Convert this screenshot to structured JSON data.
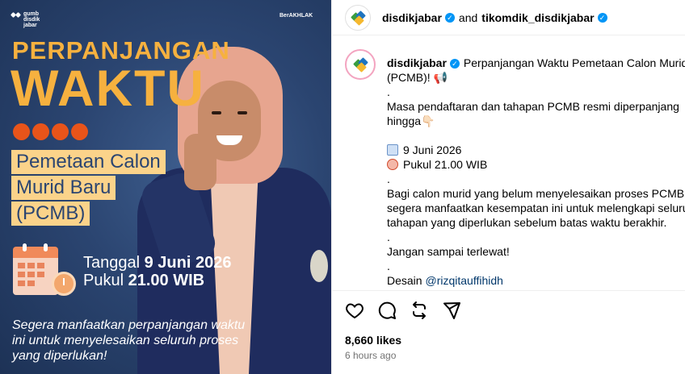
{
  "poster": {
    "logo_left": [
      "gumb",
      "disdik",
      "jabar"
    ],
    "logo_right": "BerAKHLAK",
    "logo_right_sub": "",
    "title_line1": "PERPANJANGAN",
    "title_line2": "WAKTU",
    "subject_lines": [
      "Pemetaan Calon",
      "Murid Baru",
      "(PCMB)"
    ],
    "date_label": "Tanggal",
    "date_value": "9 Juni 2026",
    "time_label": "Pukul",
    "time_value": "21.00 WIB",
    "bottom_text": "Segera manfaatkan perpanjangan waktu ini untuk menyelesaikan seluruh proses yang diperlukan!",
    "colors": {
      "accent": "#f6b13f",
      "dot": "#e8541a",
      "bg": "#2b4571"
    }
  },
  "header": {
    "user1": "disdikjabar",
    "conjunction": "and",
    "user2": "tikomdik_disdikjabar"
  },
  "caption": {
    "username": "disdikjabar",
    "line1": "Perpanjangan Waktu Pemetaan Calon Murid B",
    "line2": "(PCMB)! 📢",
    "dot1": ".",
    "line3": "Masa pendaftaran dan tahapan PCMB resmi diperpanjang",
    "line4": "hingga👇🏻",
    "date": "9 Juni 2026",
    "time": "Pukul 21.00 WIB",
    "dot2": ".",
    "line5": "Bagi calon murid yang belum menyelesaikan proses PCMB,",
    "line6": "segera manfaatkan kesempatan ini untuk melengkapi seluru",
    "line7": "tahapan yang diperlukan sebelum batas waktu berakhir.",
    "dot3": ".",
    "line8": "Jangan sampai terlewat!",
    "dot4": ".",
    "design_label": "Desain",
    "design_mention": "@rizqitauffihidh"
  },
  "engagement": {
    "likes": "8,660 likes",
    "time_ago": "6 hours ago"
  },
  "icons": [
    "heart-icon",
    "comment-icon",
    "repost-icon",
    "share-icon",
    "verified-icon",
    "calendar-icon",
    "alarm-clock-icon"
  ]
}
